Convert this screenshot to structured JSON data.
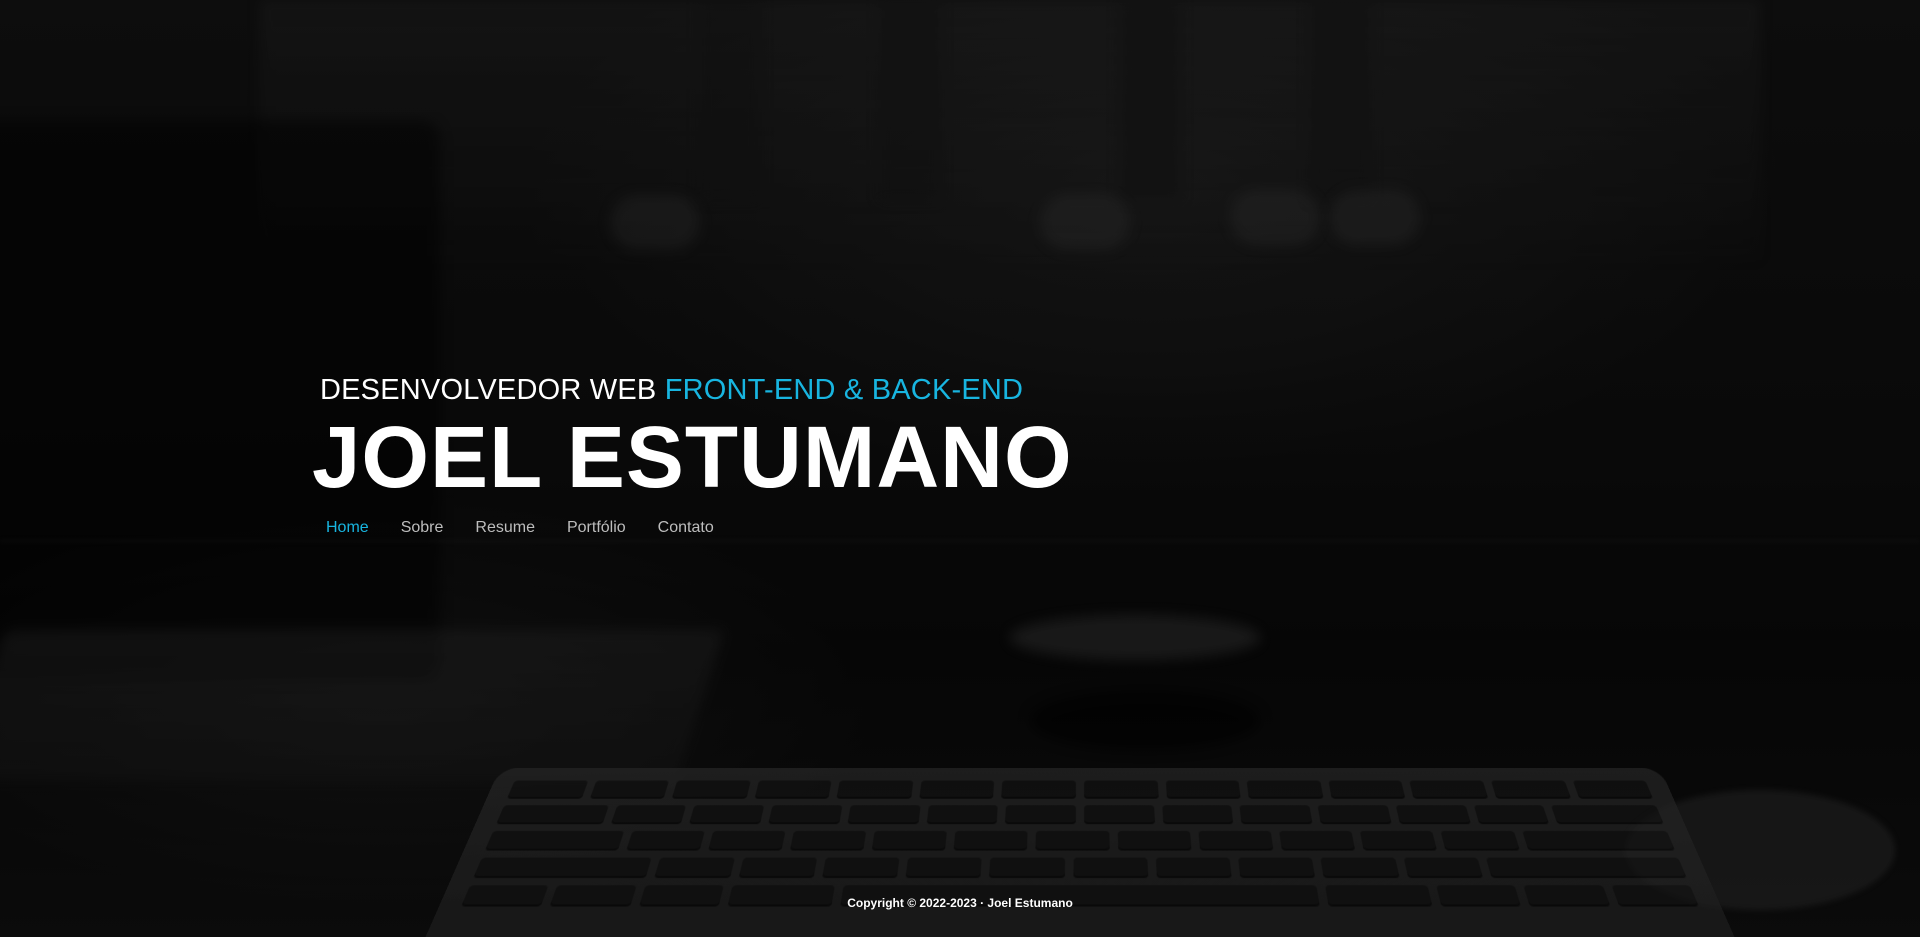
{
  "hero": {
    "subtitle_prefix": "DESENVOLVEDOR WEB",
    "subtitle_accent": "FRONT-END & BACK-END",
    "name": "JOEL ESTUMANO"
  },
  "nav": {
    "items": [
      {
        "label": "Home",
        "active": true
      },
      {
        "label": "Sobre",
        "active": false
      },
      {
        "label": "Resume",
        "active": false
      },
      {
        "label": "Portfólio",
        "active": false
      },
      {
        "label": "Contato",
        "active": false
      }
    ]
  },
  "footer": {
    "copyright": "Copyright © 2022-2023 · Joel Estumano"
  },
  "colors": {
    "accent": "#18b5e0",
    "text": "#ffffff",
    "nav_text": "#bdbdbd",
    "background": "#0d0d0d"
  }
}
